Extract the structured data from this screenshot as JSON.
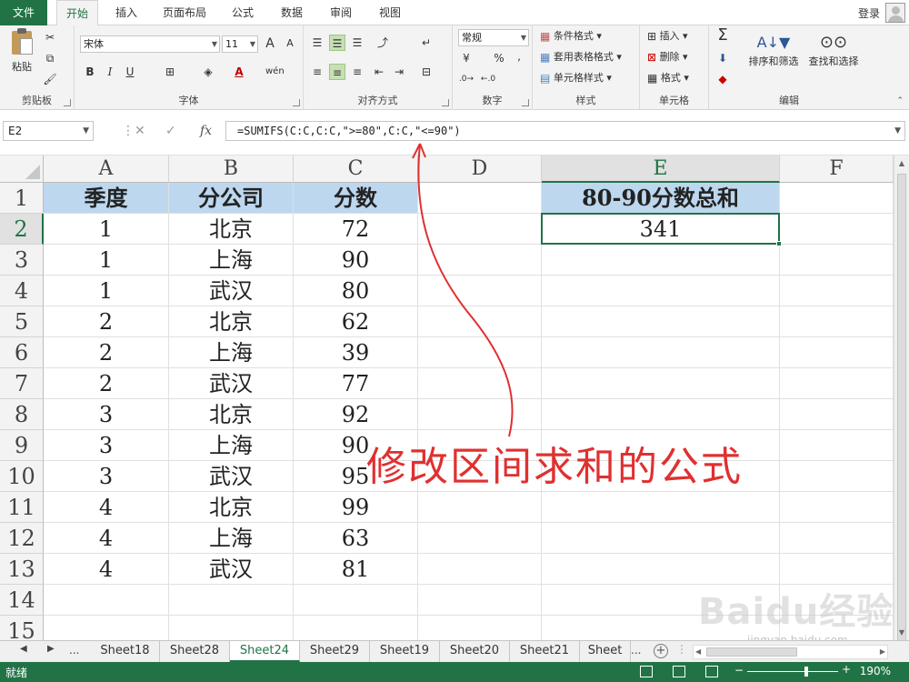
{
  "tabs": {
    "file": "文件",
    "items": [
      "开始",
      "插入",
      "页面布局",
      "公式",
      "数据",
      "审阅",
      "视图"
    ],
    "active": "开始",
    "login": "登录"
  },
  "ribbon": {
    "clipboard": {
      "label": "剪贴板",
      "paste": "粘贴"
    },
    "font": {
      "label": "字体",
      "name": "宋体",
      "size": "11",
      "bold": "B",
      "italic": "I",
      "underline": "U",
      "grow": "A",
      "shrink": "A",
      "wen": "wén",
      "font_color": "A"
    },
    "alignment": {
      "label": "对齐方式"
    },
    "number": {
      "label": "数字",
      "format": "常规",
      "percent": "%",
      "comma": ","
    },
    "styles": {
      "label": "样式",
      "conditional": "条件格式",
      "table": "套用表格格式",
      "cell_styles": "单元格样式"
    },
    "cells": {
      "label": "单元格",
      "insert": "插入",
      "delete": "删除",
      "format": "格式"
    },
    "editing": {
      "label": "编辑",
      "sum": "Σ",
      "sort_filter": "排序和筛选",
      "find_select": "查找和选择"
    }
  },
  "formula_bar": {
    "name_box": "E2",
    "cancel": "✕",
    "enter": "✓",
    "fx": "fx",
    "formula": "=SUMIFS(C:C,C:C,\">=80\",C:C,\"<=90\")"
  },
  "grid": {
    "columns": [
      "A",
      "B",
      "C",
      "D",
      "E",
      "F"
    ],
    "active_col": "E",
    "active_row": "2",
    "rows": [
      {
        "n": "1",
        "a": "季度",
        "b": "分公司",
        "c": "分数",
        "e": "80-90分数总和"
      },
      {
        "n": "2",
        "a": "1",
        "b": "北京",
        "c": "72",
        "e": "341"
      },
      {
        "n": "3",
        "a": "1",
        "b": "上海",
        "c": "90"
      },
      {
        "n": "4",
        "a": "1",
        "b": "武汉",
        "c": "80"
      },
      {
        "n": "5",
        "a": "2",
        "b": "北京",
        "c": "62"
      },
      {
        "n": "6",
        "a": "2",
        "b": "上海",
        "c": "39"
      },
      {
        "n": "7",
        "a": "2",
        "b": "武汉",
        "c": "77"
      },
      {
        "n": "8",
        "a": "3",
        "b": "北京",
        "c": "92"
      },
      {
        "n": "9",
        "a": "3",
        "b": "上海",
        "c": "90"
      },
      {
        "n": "10",
        "a": "3",
        "b": "武汉",
        "c": "95"
      },
      {
        "n": "11",
        "a": "4",
        "b": "北京",
        "c": "99"
      },
      {
        "n": "12",
        "a": "4",
        "b": "上海",
        "c": "63"
      },
      {
        "n": "13",
        "a": "4",
        "b": "武汉",
        "c": "81"
      },
      {
        "n": "14"
      },
      {
        "n": "15"
      }
    ]
  },
  "annotation": "修改区间求和的公式",
  "sheets": {
    "tabs": [
      "Sheet18",
      "Sheet28",
      "Sheet24",
      "Sheet29",
      "Sheet19",
      "Sheet20",
      "Sheet21",
      "Sheet"
    ],
    "active": "Sheet24",
    "more": "...",
    "overflow": "..."
  },
  "status": {
    "ready": "就绪",
    "zoom": "190%"
  },
  "watermark": {
    "main": "Baidu经验",
    "sub": "jingyan.baidu.com"
  },
  "colors": {
    "accent": "#217346",
    "header_fill": "#bdd7ee",
    "annotation": "#e03030"
  }
}
